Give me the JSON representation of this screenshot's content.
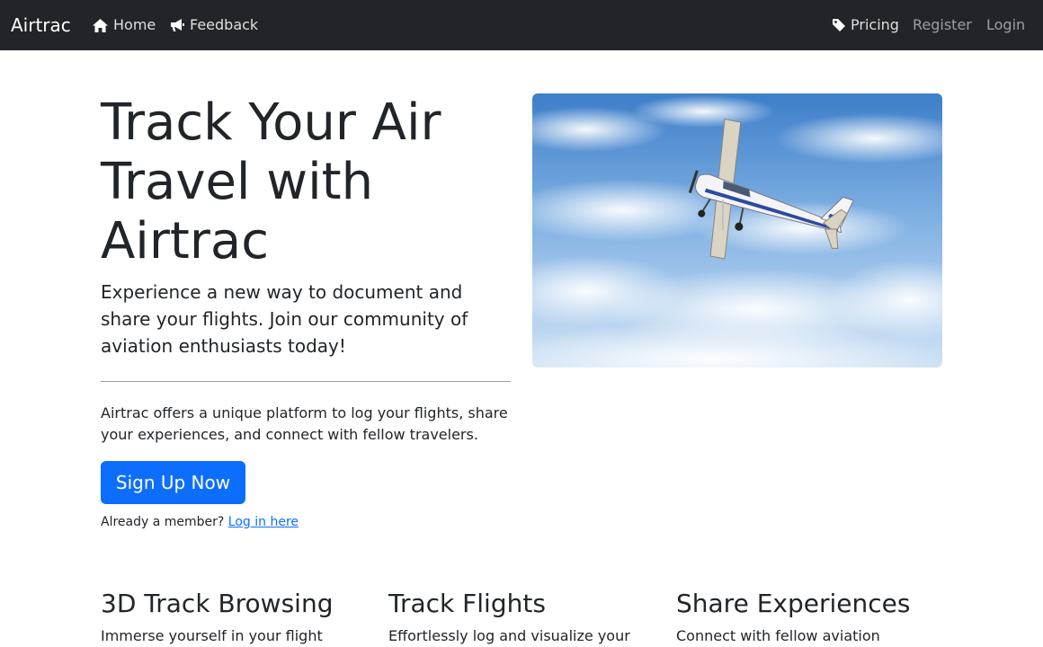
{
  "navbar": {
    "brand": "Airtrac",
    "left_links": [
      {
        "label": "Home",
        "icon": "home-icon"
      },
      {
        "label": "Feedback",
        "icon": "megaphone-icon"
      }
    ],
    "right_links": [
      {
        "label": "Pricing",
        "icon": "tag-icon"
      },
      {
        "label": "Register"
      },
      {
        "label": "Login"
      }
    ]
  },
  "hero": {
    "title": "Track Your Air Travel with Airtrac",
    "lead": "Experience a new way to document and share your flights. Join our community of aviation enthusiasts today!",
    "description": "Airtrac offers a unique platform to log your flights, share your experiences, and connect with fellow travelers.",
    "cta_label": "Sign Up Now",
    "member_prompt": "Already a member?",
    "login_link": "Log in here",
    "image_alt": "airplane-photo"
  },
  "features": [
    {
      "title": "3D Track Browsing",
      "text": "Immerse yourself in your flight"
    },
    {
      "title": "Track Flights",
      "text": "Effortlessly log and visualize your"
    },
    {
      "title": "Share Experiences",
      "text": "Connect with fellow aviation"
    }
  ],
  "colors": {
    "navbar_bg": "#212529",
    "primary": "#0d6efd",
    "text": "#212529"
  }
}
